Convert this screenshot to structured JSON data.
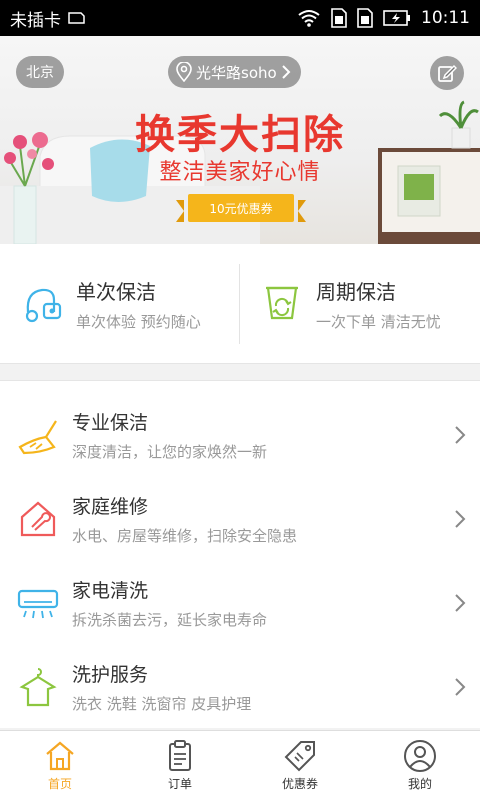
{
  "status_bar": {
    "carrier": "未插卡",
    "time": "10:11",
    "icons": [
      "sim-icon",
      "wifi-icon",
      "sim-card-icon",
      "sim-card-icon",
      "battery-charging-icon"
    ]
  },
  "banner": {
    "city": "北京",
    "location": "光华路soho",
    "title": "换季大扫除",
    "subtitle": "整洁美家好心情",
    "coupon": "10元优惠券",
    "colors": {
      "title": "#e8382f",
      "ribbon": "#f5b51b"
    }
  },
  "cards": [
    {
      "title": "单次保洁",
      "desc": "单次体验 预约随心",
      "icon": "vacuum-icon",
      "color": "#3fb3e8"
    },
    {
      "title": "周期保洁",
      "desc": "一次下单 清洁无忧",
      "icon": "cycle-bucket-icon",
      "color": "#8cc63f"
    }
  ],
  "services": [
    {
      "title": "专业保洁",
      "desc": "深度清洁，让您的家焕然一新",
      "icon": "broom-icon",
      "color": "#f5b51b"
    },
    {
      "title": "家庭维修",
      "desc": "水电、房屋等维修，扫除安全隐患",
      "icon": "house-wrench-icon",
      "color": "#ef5a5a"
    },
    {
      "title": "家电清洗",
      "desc": "拆洗杀菌去污，延长家电寿命",
      "icon": "air-conditioner-icon",
      "color": "#3fb3e8"
    },
    {
      "title": "洗护服务",
      "desc": "洗衣 洗鞋 洗窗帘 皮具护理",
      "icon": "clothes-hanger-icon",
      "color": "#8cc63f"
    }
  ],
  "tabs": [
    {
      "label": "首页",
      "icon": "home-icon",
      "active": true
    },
    {
      "label": "订单",
      "icon": "order-clipboard-icon",
      "active": false
    },
    {
      "label": "优惠券",
      "icon": "coupon-tag-icon",
      "active": false
    },
    {
      "label": "我的",
      "icon": "user-icon",
      "active": false
    }
  ],
  "accent_color": "#f5a623"
}
